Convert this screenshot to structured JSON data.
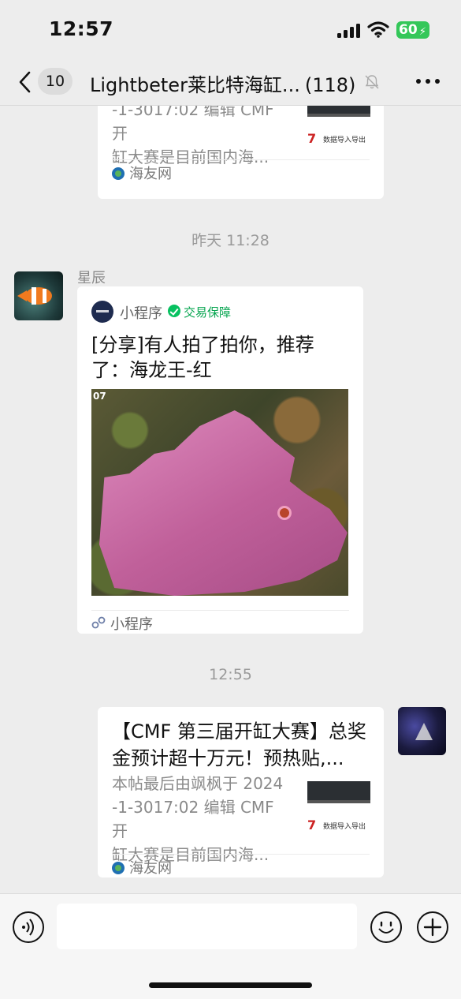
{
  "status_bar": {
    "time": "12:57",
    "battery": "60",
    "battery_color": "#34c759",
    "icons": [
      "signal-icon",
      "wifi-icon",
      "battery-icon"
    ]
  },
  "nav": {
    "unread": "10",
    "title": "Lightbeter莱比特海缸...",
    "member_count": "(118)",
    "icons": [
      "back-icon",
      "mute-icon",
      "more-icon"
    ]
  },
  "messages": {
    "top_card": {
      "desc_lines": [
        "-1-3017:02 编辑 CMF 开",
        "缸大赛是目前国内海..."
      ],
      "source": "海友网"
    },
    "timestamp1": "昨天 11:28",
    "mini_message": {
      "sender": "星辰",
      "app_name": "小程序",
      "guarantee": "交易保障",
      "title": "[分享]有人拍了拍你，推荐了：海龙王-红",
      "image_tag": "07",
      "footer": "小程序"
    },
    "timestamp2": "12:55",
    "bottom_card": {
      "title": "【CMF 第三届开缸大赛】总奖金预计超十万元！预热贴,...",
      "desc_lines": [
        "本帖最后由飒枫于 2024",
        "-1-3017:02 编辑 CMF 开",
        "缸大赛是目前国内海..."
      ],
      "source": "海友网"
    }
  },
  "thumb": {
    "number": "7",
    "caption": "数据导入导出"
  },
  "colors": {
    "background": "#ededed",
    "accent_green": "#07c160"
  }
}
